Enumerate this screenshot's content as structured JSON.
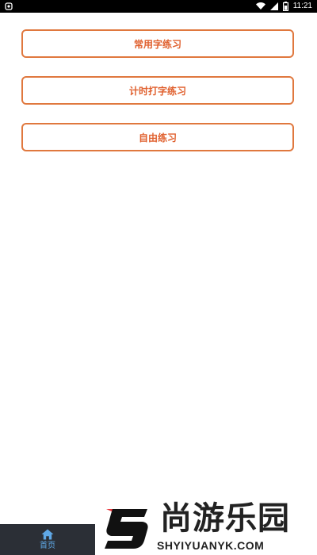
{
  "status_bar": {
    "time": "11:21",
    "icons": [
      "notification-icon",
      "wifi-icon",
      "signal-icon",
      "battery-icon"
    ]
  },
  "menu": {
    "buttons": [
      {
        "label": "常用字练习"
      },
      {
        "label": "计时打字练习"
      },
      {
        "label": "自由练习"
      }
    ]
  },
  "tab_bar": {
    "home_label": "首页",
    "home_icon": "home-icon",
    "active_color": "#5fa8e6"
  },
  "watermark": {
    "chinese": "尚游乐园",
    "english": "SHYIYUANYK.COM"
  },
  "colors": {
    "button_border": "#e0783e",
    "button_text": "#e0602e",
    "tab_background": "#2b2f36"
  }
}
